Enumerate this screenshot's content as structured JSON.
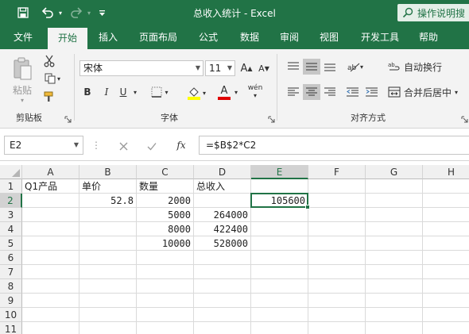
{
  "window": {
    "title": "总收入统计 - Excel",
    "tell_me": "操作说明搜",
    "brand_color": "#217346"
  },
  "quick_access": {
    "save_icon": "save-icon",
    "undo_icon": "undo-icon",
    "redo_icon": "redo-icon",
    "customize_icon": "customize-qat-icon"
  },
  "tabs": [
    "文件",
    "开始",
    "插入",
    "页面布局",
    "公式",
    "数据",
    "审阅",
    "视图",
    "开发工具",
    "帮助"
  ],
  "active_tab": "开始",
  "ribbon": {
    "clipboard": {
      "label": "剪贴板",
      "paste": "粘贴"
    },
    "font": {
      "label": "字体",
      "font_name": "宋体",
      "font_size": "11",
      "bold": "B",
      "italic": "I",
      "underline": "U",
      "font_color_letter": "A",
      "phonetic": "wén"
    },
    "alignment": {
      "label": "对齐方式",
      "wrap_text": "自动换行",
      "merge_center": "合并后居中"
    }
  },
  "formula_bar": {
    "name_box": "E2",
    "formula": "=$B$2*C2",
    "fx": "fx"
  },
  "sheet": {
    "columns": [
      "A",
      "B",
      "C",
      "D",
      "E",
      "F",
      "G",
      "H"
    ],
    "rows": [
      "1",
      "2",
      "3",
      "4",
      "5",
      "6",
      "7",
      "8",
      "9",
      "10",
      "11"
    ],
    "active_cell": "E2",
    "cells": {
      "A1": "Q1产品",
      "B1": "单价",
      "C1": "数量",
      "D1": "总收入",
      "B2": "52.8",
      "C2": "2000",
      "E2": "105600",
      "C3": "5000",
      "D3": "264000",
      "C4": "8000",
      "D4": "422400",
      "C5": "10000",
      "D5": "528000"
    }
  }
}
